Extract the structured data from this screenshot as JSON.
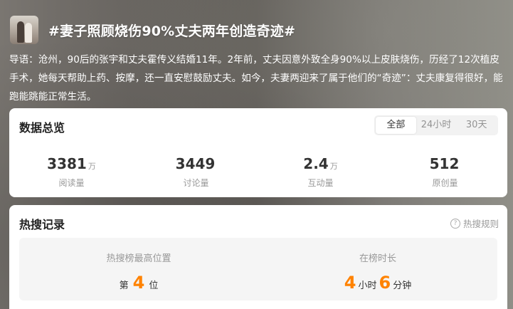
{
  "topic": {
    "title": "#妻子照顾烧伤90%丈夫两年创造奇迹#",
    "intro": "导语：沧州，90后的张宇和丈夫霍传义结婚11年。2年前，丈夫因意外致全身90%以上皮肤烧伤，历经了12次植皮手术，她每天帮助上药、按摩，还一直安慰鼓励丈夫。如今，夫妻两迎来了属于他们的“奇迹”：丈夫康复得很好，能跑能跳能正常生活。"
  },
  "overview": {
    "title": "数据总览",
    "tabs": [
      "全部",
      "24小时",
      "30天"
    ],
    "active_tab": "全部",
    "stats": [
      {
        "value": "3381",
        "unit": "万",
        "label": "阅读量"
      },
      {
        "value": "3449",
        "unit": "",
        "label": "讨论量"
      },
      {
        "value": "2.4",
        "unit": "万",
        "label": "互动量"
      },
      {
        "value": "512",
        "unit": "",
        "label": "原创量"
      }
    ]
  },
  "hot": {
    "title": "热搜记录",
    "rules_link": "热搜规则",
    "peak_label": "热搜榜最高位置",
    "peak_prefix": "第",
    "peak_value": "4",
    "peak_suffix": "位",
    "duration_label": "在榜时长",
    "hours": "4",
    "hours_unit": "小时",
    "minutes": "6",
    "minutes_unit": "分钟"
  },
  "colors": {
    "accent": "#ff8200"
  }
}
